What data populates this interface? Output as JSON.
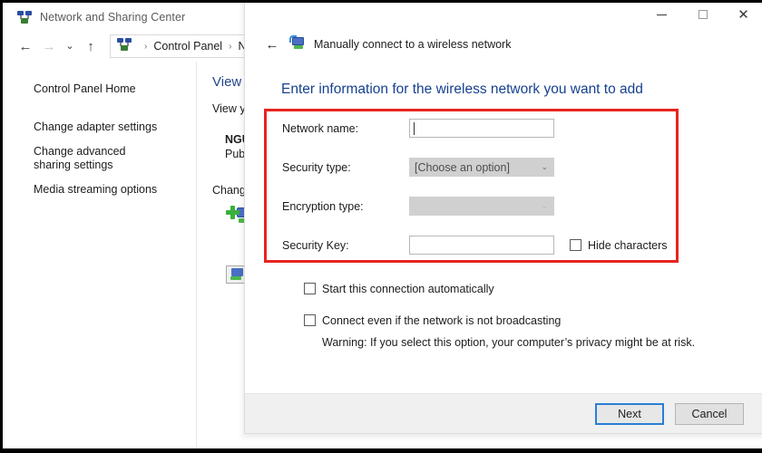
{
  "background_window": {
    "title": "Network and Sharing Center",
    "title_icon": "network-sharing-icon",
    "nav": {
      "back": "←",
      "forward": "→",
      "recent": "⌄",
      "up": "↑"
    },
    "breadcrumb": {
      "icon": "network-sharing-icon",
      "sep": "›",
      "items": [
        "Control Panel",
        "Netw"
      ]
    },
    "sidebar": {
      "items": [
        {
          "label": "Control Panel Home"
        },
        {
          "label": "Change adapter settings"
        },
        {
          "label": "Change advanced sharing settings"
        },
        {
          "label": "Media streaming options"
        }
      ]
    },
    "content": {
      "heading": "View y",
      "subheading": "View yo",
      "network_name": "NGU",
      "network_type": "Publ",
      "change_label": "Change",
      "icon_new_connection": "add-connection-icon",
      "icon_troubleshoot": "troubleshoot-icon"
    }
  },
  "dialog": {
    "window_controls": {
      "minimize": "minimize-icon",
      "maximize": "maximize-icon",
      "close": "✕"
    },
    "back_arrow": "←",
    "header_icon": "wireless-network-icon",
    "header_title": "Manually connect to a wireless network",
    "wizard_heading": "Enter information for the wireless network you want to add",
    "highlight_color": "#e8241f",
    "heading_color": "#16408f",
    "fields": [
      {
        "label": "Network name:",
        "type": "text",
        "value": "",
        "name": "network-name-input",
        "disabled": false
      },
      {
        "label": "Security type:",
        "type": "select",
        "value": "[Choose an option]",
        "name": "security-type-select",
        "disabled": true,
        "chevron": "⌄"
      },
      {
        "label": "Encryption type:",
        "type": "select",
        "value": "",
        "name": "encryption-type-select",
        "disabled": true,
        "chevron": "⌄"
      },
      {
        "label": "Security Key:",
        "type": "text",
        "value": "",
        "name": "security-key-input",
        "disabled": false
      }
    ],
    "hide_characters": {
      "label": "Hide characters",
      "checked": false
    },
    "options": [
      {
        "label": "Start this connection automatically",
        "checked": false
      },
      {
        "label": "Connect even if the network is not broadcasting",
        "checked": false
      }
    ],
    "warning": "Warning: If you select this option, your computer’s privacy might be at risk.",
    "buttons": {
      "next": "Next",
      "cancel": "Cancel"
    }
  }
}
